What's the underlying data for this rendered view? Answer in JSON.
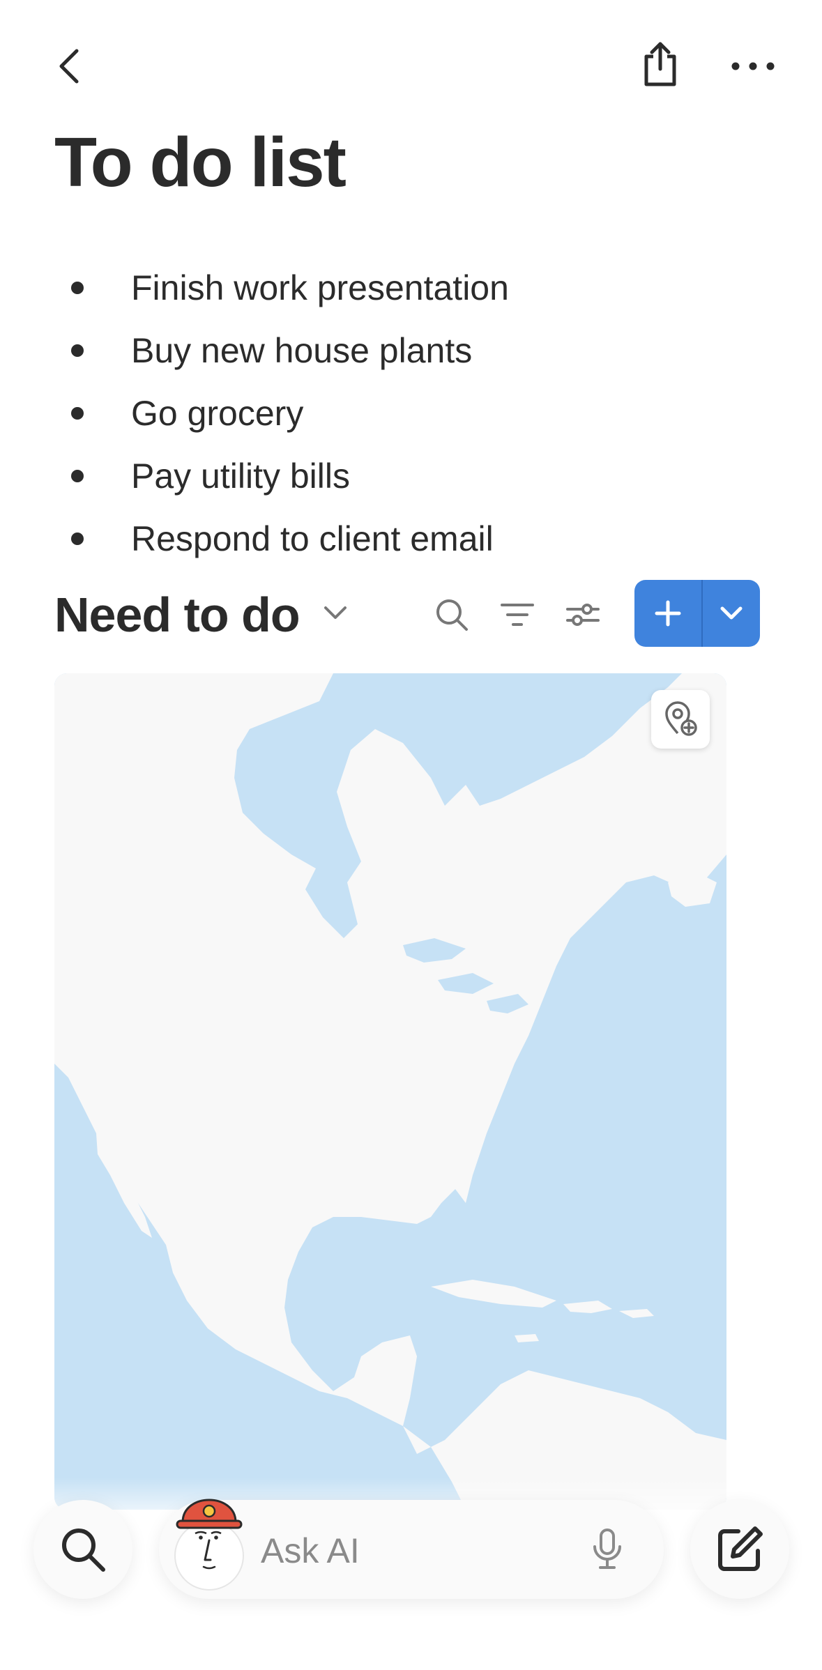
{
  "page": {
    "title": "To do list"
  },
  "todo_items": [
    "Finish work presentation",
    "Buy new house plants",
    "Go grocery",
    "Pay utility bills",
    "Respond to client email"
  ],
  "section": {
    "title": "Need to do"
  },
  "ask_ai": {
    "placeholder": "Ask AI"
  },
  "icons": {
    "back": "chevron-left-icon",
    "share": "share-icon",
    "more": "more-icon",
    "dropdown": "chevron-down-icon",
    "search": "search-icon",
    "filter": "filter-icon",
    "settings": "sliders-icon",
    "add": "plus-icon",
    "add_menu": "chevron-down-icon",
    "add_location": "location-plus-icon",
    "microphone": "microphone-icon",
    "compose": "compose-icon",
    "avatar": "ai-avatar-icon"
  },
  "colors": {
    "accent": "#3f83dd",
    "water": "#c6e1f5",
    "land": "#f7f7f7",
    "text": "#2b2b2b"
  }
}
